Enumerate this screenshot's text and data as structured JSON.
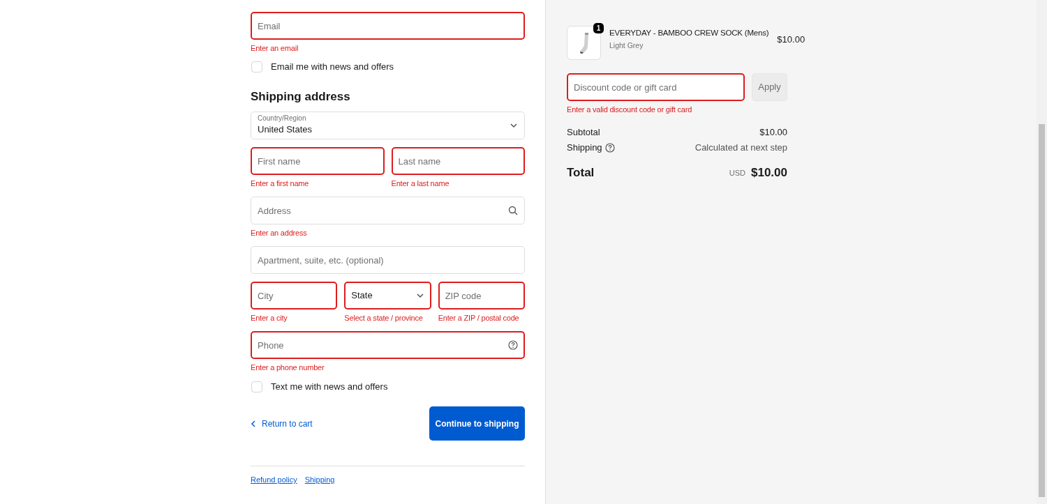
{
  "contact": {
    "fields": [
      {
        "kind": "text",
        "placeholder": "Email",
        "invalid": true,
        "error": "Enter an email"
      }
    ],
    "checkbox": {
      "label": "Email me with news and offers",
      "checked": false
    }
  },
  "shipping": {
    "heading": "Shipping address",
    "rows": [
      [
        {
          "kind": "select",
          "label": "Country/Region",
          "value": "United States",
          "invalid": false
        }
      ],
      [
        {
          "kind": "text",
          "placeholder": "First name",
          "invalid": true,
          "error": "Enter a first name"
        },
        {
          "kind": "text",
          "placeholder": "Last name",
          "invalid": true,
          "error": "Enter a last name"
        }
      ],
      [
        {
          "kind": "search",
          "placeholder": "Address",
          "invalid": false,
          "error": "Enter an address"
        }
      ],
      [
        {
          "kind": "text",
          "placeholder": "Apartment, suite, etc. (optional)",
          "invalid": false
        }
      ],
      [
        {
          "kind": "text",
          "placeholder": "City",
          "invalid": true,
          "error": "Enter a city"
        },
        {
          "kind": "select",
          "value": "State",
          "invalid": true,
          "error": "Select a state / province"
        },
        {
          "kind": "text",
          "placeholder": "ZIP code",
          "invalid": true,
          "error": "Enter a ZIP / postal code"
        }
      ],
      [
        {
          "kind": "help",
          "placeholder": "Phone",
          "invalid": true,
          "error": "Enter a phone number"
        }
      ]
    ],
    "checkbox": {
      "label": "Text me with news and offers",
      "checked": false
    }
  },
  "actions": {
    "back": "Return to cart",
    "primary": "Continue to shipping"
  },
  "footer_links": [
    "Refund policy",
    "Shipping"
  ],
  "summary": {
    "items": [
      {
        "quantity": "1",
        "title": "EVERYDAY - BAMBOO CREW SOCK (Mens)",
        "variant": "Light Grey",
        "price": "$10.00"
      }
    ],
    "discount": {
      "placeholder": "Discount code or gift card",
      "invalid": true,
      "error": "Enter a valid discount code or gift card",
      "button": "Apply",
      "disabled": true
    },
    "lines": [
      {
        "kind": "plain",
        "label": "Subtotal",
        "value": "$10.00"
      },
      {
        "kind": "help",
        "label": "Shipping",
        "value": "Calculated at next step"
      }
    ],
    "total": {
      "label": "Total",
      "currency": "USD",
      "value": "$10.00"
    }
  }
}
